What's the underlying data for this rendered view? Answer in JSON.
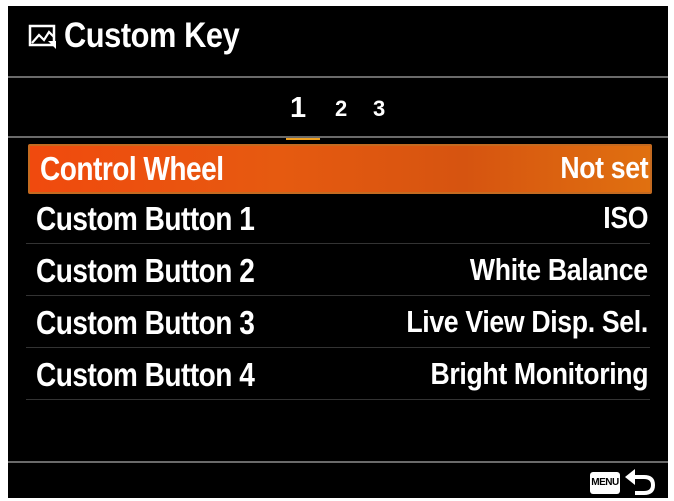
{
  "header": {
    "title": "Custom Key",
    "icon": "custom-key-image-icon"
  },
  "pages": {
    "tabs": [
      "1",
      "2",
      "3"
    ],
    "active": "1"
  },
  "rows": [
    {
      "label": "Control Wheel",
      "value": "Not set",
      "selected": true
    },
    {
      "label": "Custom Button 1",
      "value": "ISO",
      "selected": false
    },
    {
      "label": "Custom Button 2",
      "value": "White Balance",
      "selected": false
    },
    {
      "label": "Custom Button 3",
      "value": "Live View Disp. Sel.",
      "selected": false
    },
    {
      "label": "Custom Button 4",
      "value": "Bright Monitoring",
      "selected": false
    }
  ],
  "footer": {
    "menu_label": "MENU",
    "back_icon": "return-arrow-icon"
  },
  "colors": {
    "background": "#000000",
    "selection": "#e65a10",
    "tab_underline": "#f0a020",
    "text": "#ffffff"
  }
}
